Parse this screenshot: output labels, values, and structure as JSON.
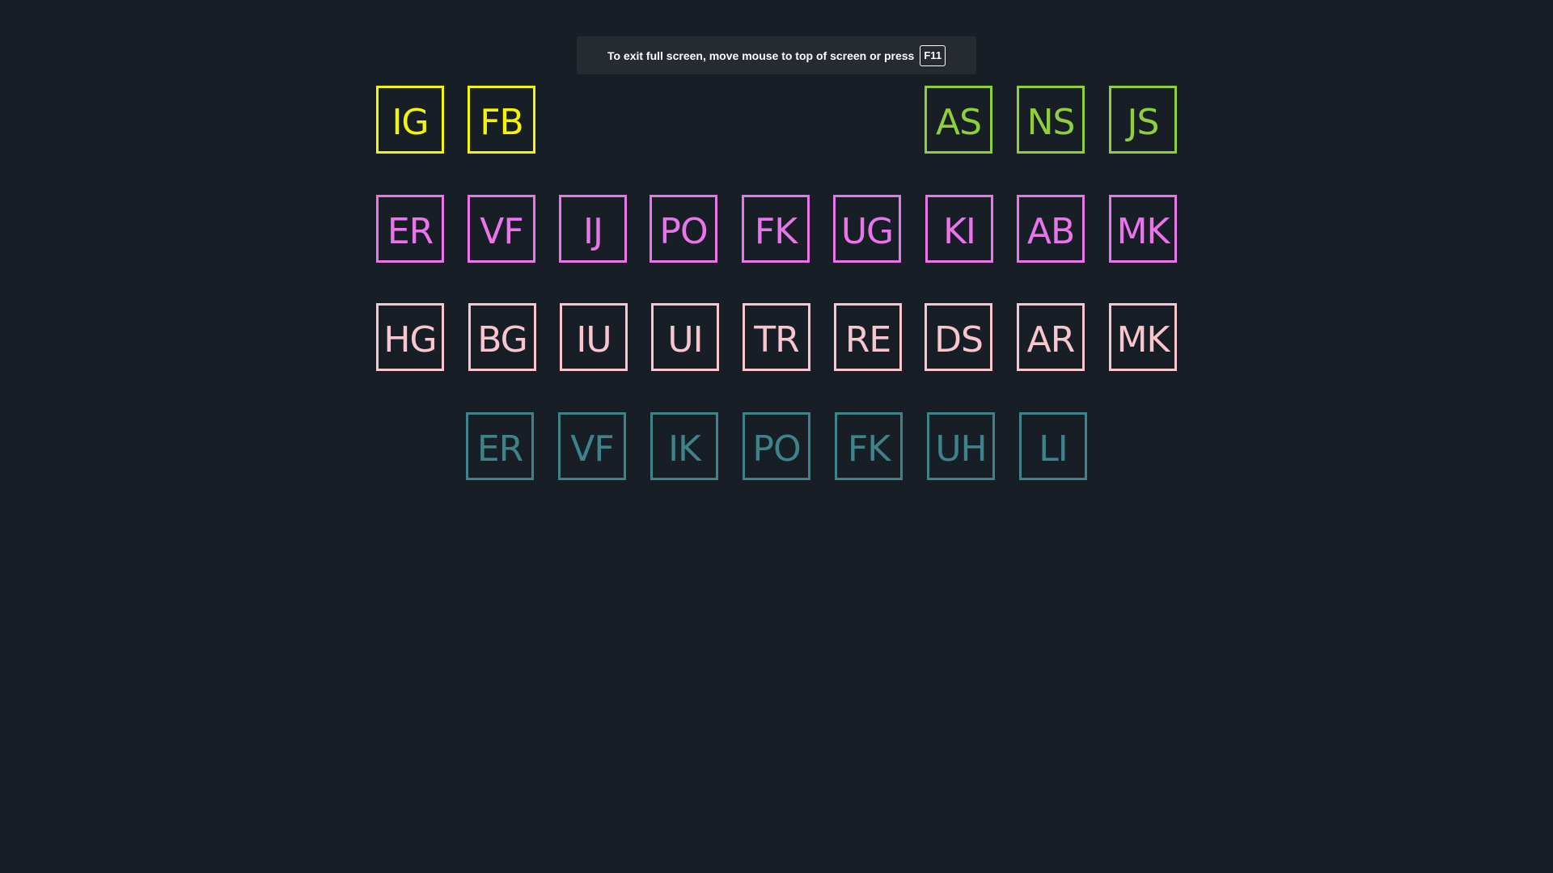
{
  "banner": {
    "text": "To exit full screen, move mouse to top of screen or press",
    "key": "F11"
  },
  "colors": {
    "background": "#181e25",
    "row1_left": "#f5f500",
    "row1_right": "#8fcf3a",
    "row2": "#ea74ec",
    "row3": "#f7c6cf",
    "row4": "#3f838a"
  },
  "rows": [
    {
      "name": "row-1",
      "tiles": [
        "IG",
        "FB",
        "AS",
        "NS",
        "JS"
      ]
    },
    {
      "name": "row-2",
      "tiles": [
        "ER",
        "VF",
        "IJ",
        "PO",
        "FK",
        "UG",
        "KI",
        "AB",
        "MK"
      ]
    },
    {
      "name": "row-3",
      "tiles": [
        "HG",
        "BG",
        "IU",
        "UI",
        "TR",
        "RE",
        "DS",
        "AR",
        "MK"
      ]
    },
    {
      "name": "row-4",
      "tiles": [
        "ER",
        "VF",
        "IK",
        "PO",
        "FK",
        "UH",
        "LI"
      ]
    }
  ]
}
